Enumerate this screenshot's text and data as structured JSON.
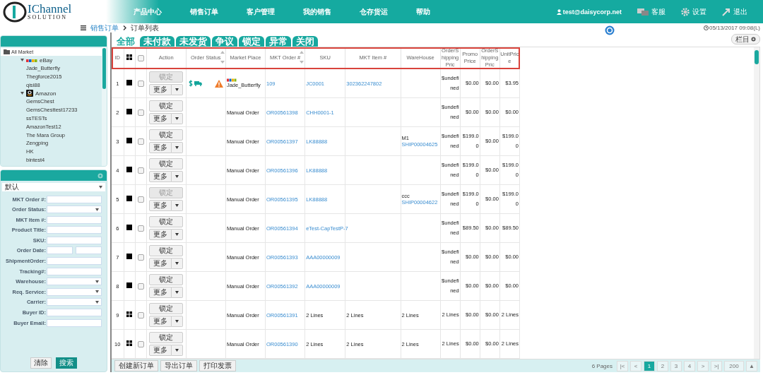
{
  "header": {
    "logo": {
      "main": "IChannel",
      "sub": "SOLUTION"
    },
    "nav": [
      "产品中心",
      "销售订单",
      "客户管理",
      "我的销售",
      "仓存货运",
      "帮助"
    ],
    "user": "test@daisycorp.net",
    "actions": [
      {
        "kind": "support",
        "label": "客服"
      },
      {
        "kind": "settings",
        "label": "设置"
      },
      {
        "kind": "logout",
        "label": "退出"
      }
    ]
  },
  "breadcrumb": {
    "items": [
      "销售订单",
      "订单列表"
    ],
    "timestamp": "05/13/2017 09:08(L)"
  },
  "tree": {
    "root": {
      "label": "All Market",
      "selected": true
    },
    "children": [
      {
        "label": "eBay",
        "kind": "ebay",
        "expanded": true,
        "selected": false,
        "children": [
          {
            "label": "Jade_Butterfly",
            "selected": false
          },
          {
            "label": "Thegforce2015",
            "selected": false
          },
          {
            "label": "qisi88",
            "selected": false
          }
        ]
      },
      {
        "label": "Amazon",
        "kind": "amazon",
        "expanded": true,
        "selected": false,
        "children": [
          {
            "label": "GemsChest",
            "selected": false
          },
          {
            "label": "GemsChesttest17233",
            "selected": false
          },
          {
            "label": "ssTESTs",
            "selected": false
          },
          {
            "label": "AmazonTest12",
            "selected": false
          },
          {
            "label": "The Mara Group",
            "selected": false
          },
          {
            "label": "Zengping",
            "selected": false
          },
          {
            "label": "HK",
            "selected": false
          },
          {
            "label": "bintest4",
            "selected": false
          }
        ]
      }
    ]
  },
  "filter": {
    "preset": "默认",
    "fields": [
      {
        "label": "MKT Order #:",
        "kind": "text"
      },
      {
        "label": "Order Status:",
        "kind": "select"
      },
      {
        "label": "MKT Item #:",
        "kind": "text"
      },
      {
        "label": "Product Title:",
        "kind": "text"
      },
      {
        "label": "SKU:",
        "kind": "text"
      },
      {
        "label": "Order Date:",
        "kind": "range"
      },
      {
        "label": "ShipmentOrder:",
        "kind": "text"
      },
      {
        "label": "Tracking#:",
        "kind": "text"
      },
      {
        "label": "Warehouse:",
        "kind": "select"
      },
      {
        "label": "Req. Service:",
        "kind": "select"
      },
      {
        "label": "Carrier:",
        "kind": "select"
      },
      {
        "label": "Buyer ID:",
        "kind": "text"
      },
      {
        "label": "Buyer Email:",
        "kind": "text"
      }
    ],
    "buttons": [
      {
        "label": "清除",
        "primary": false
      },
      {
        "label": "搜索",
        "primary": true
      }
    ]
  },
  "tabs": [
    {
      "label": "全部",
      "selected": true
    },
    {
      "label": "未付款",
      "selected": false
    },
    {
      "label": "未发货",
      "selected": false
    },
    {
      "label": "争议",
      "selected": false
    },
    {
      "label": "锁定",
      "selected": false
    },
    {
      "label": "异常",
      "selected": false
    },
    {
      "label": "关闭",
      "selected": false
    }
  ],
  "column_button": "栏目",
  "table": {
    "select_all_checked": false,
    "columns": [
      {
        "label": "ID",
        "sortable": false
      },
      {
        "label": "Action",
        "sortable": false
      },
      {
        "label": "Order Status",
        "sortable": true
      },
      {
        "label": "Market Place",
        "sortable": false
      },
      {
        "label": "MKT Order #",
        "sortable": true
      },
      {
        "label": "SKU",
        "sortable": false
      },
      {
        "label": "MKT Item #",
        "sortable": false
      },
      {
        "label": "WareHouse",
        "sortable": false
      },
      {
        "label": "OrderShippingPric",
        "sortable": false
      },
      {
        "label": "PromoPrice",
        "sortable": false
      },
      {
        "label": "OrderShippingPric",
        "sortable": false
      },
      {
        "label": "UnitPrice",
        "sortable": false
      }
    ],
    "rows": [
      {
        "id": "1",
        "kind": "single",
        "checked": false,
        "lock": "锁定",
        "lock_disabled": true,
        "more": "更多",
        "paid": true,
        "shipped": true,
        "alert": true,
        "market_logo": true,
        "market": "Jade_Butterfly",
        "order": "109",
        "sku": "JC0001",
        "sku_link": true,
        "item": "302362247802",
        "warehouse": "",
        "shipment": "",
        "shipping": "$undefined",
        "promo": "$0.00",
        "shipping2": "$0.00",
        "unit": "$3.95"
      },
      {
        "id": "2",
        "kind": "single",
        "checked": false,
        "lock": "锁定",
        "lock_disabled": false,
        "more": "更多",
        "paid": false,
        "shipped": false,
        "alert": false,
        "market_logo": false,
        "market": "Manual Order",
        "order": "OR00561398",
        "sku": "CHH0001-1",
        "sku_link": true,
        "item": "",
        "warehouse": "",
        "shipment": "",
        "shipping": "$undefined",
        "promo": "$0.00",
        "shipping2": "$0.00",
        "unit": "$0.00"
      },
      {
        "id": "3",
        "kind": "single",
        "checked": false,
        "lock": "锁定",
        "lock_disabled": false,
        "more": "更多",
        "paid": false,
        "shipped": false,
        "alert": false,
        "market_logo": false,
        "market": "Manual Order",
        "order": "OR00561397",
        "sku": "LK88888",
        "sku_link": true,
        "item": "",
        "warehouse": "M1",
        "shipment": "SHIP00004625",
        "shipping": "$undefined",
        "promo": "$199.00",
        "shipping2": "$0.00",
        "unit": "$199.00"
      },
      {
        "id": "4",
        "kind": "single",
        "checked": false,
        "lock": "锁定",
        "lock_disabled": false,
        "more": "更多",
        "paid": false,
        "shipped": false,
        "alert": false,
        "market_logo": false,
        "market": "Manual Order",
        "order": "OR00561396",
        "sku": "LK88888",
        "sku_link": true,
        "item": "",
        "warehouse": "",
        "shipment": "",
        "shipping": "$undefined",
        "promo": "$199.00",
        "shipping2": "$0.00",
        "unit": "$199.00"
      },
      {
        "id": "5",
        "kind": "single",
        "checked": false,
        "lock": "锁定",
        "lock_disabled": true,
        "more": "更多",
        "paid": false,
        "shipped": false,
        "alert": false,
        "market_logo": false,
        "market": "Manual Order",
        "order": "OR00561395",
        "sku": "LK88888",
        "sku_link": true,
        "item": "",
        "warehouse": "ccc",
        "shipment": "SHIP00004622",
        "shipping": "$undefined",
        "promo": "$199.00",
        "shipping2": "$0.00",
        "unit": "$199.00"
      },
      {
        "id": "6",
        "kind": "single",
        "checked": false,
        "lock": "锁定",
        "lock_disabled": false,
        "more": "更多",
        "paid": false,
        "shipped": false,
        "alert": false,
        "market_logo": false,
        "market": "Manual Order",
        "order": "OR00561394",
        "sku": "eTest-CapTestP-7",
        "sku_link": true,
        "item": "",
        "warehouse": "",
        "shipment": "",
        "shipping": "$undefined",
        "promo": "$89.50",
        "shipping2": "$0.00",
        "unit": "$89.50"
      },
      {
        "id": "7",
        "kind": "single",
        "checked": false,
        "lock": "锁定",
        "lock_disabled": false,
        "more": "更多",
        "paid": false,
        "shipped": false,
        "alert": false,
        "market_logo": false,
        "market": "Manual Order",
        "order": "OR00561393",
        "sku": "AAA00000009",
        "sku_link": true,
        "item": "",
        "warehouse": "",
        "shipment": "",
        "shipping": "$undefined",
        "promo": "$0.00",
        "shipping2": "$0.00",
        "unit": "$0.00"
      },
      {
        "id": "8",
        "kind": "single",
        "checked": false,
        "lock": "锁定",
        "lock_disabled": false,
        "more": "更多",
        "paid": false,
        "shipped": false,
        "alert": false,
        "market_logo": false,
        "market": "Manual Order",
        "order": "OR00561392",
        "sku": "AAA00000009",
        "sku_link": true,
        "item": "",
        "warehouse": "",
        "shipment": "",
        "shipping": "$undefined",
        "promo": "$0.00",
        "shipping2": "$0.00",
        "unit": "$0.00"
      },
      {
        "id": "9",
        "kind": "multi",
        "checked": false,
        "lock": "锁定",
        "lock_disabled": false,
        "more": "更多",
        "paid": false,
        "shipped": false,
        "alert": false,
        "market_logo": false,
        "market": "Manual Order",
        "order": "OR00561391",
        "sku": "2 Lines",
        "sku_link": false,
        "item": "2 Lines",
        "warehouse": "2 Lines",
        "shipment": "",
        "shipping": "2 Lines",
        "promo": "$0.00",
        "shipping2": "$0.00",
        "unit": "2 Lines"
      },
      {
        "id": "10",
        "kind": "multi",
        "checked": false,
        "lock": "锁定",
        "lock_disabled": false,
        "more": "更多",
        "paid": false,
        "shipped": false,
        "alert": false,
        "market_logo": false,
        "market": "Manual Order",
        "order": "OR00561390",
        "sku": "2 Lines",
        "sku_link": false,
        "item": "2 Lines",
        "warehouse": "2 Lines",
        "shipment": "",
        "shipping": "2 Lines",
        "promo": "$0.00",
        "shipping2": "$0.00",
        "unit": "2 Lines"
      }
    ]
  },
  "footer_buttons": [
    "创建新订单",
    "导出订单",
    "打印发票"
  ],
  "pagination": {
    "summary": "6 Pages",
    "first": "|<",
    "prev": "<",
    "pages": [
      {
        "label": "1",
        "selected": true
      },
      {
        "label": "2",
        "selected": false
      },
      {
        "label": "3",
        "selected": false
      },
      {
        "label": "4",
        "selected": false
      }
    ],
    "next": ">",
    "last": ">|",
    "page_size": "200",
    "size_toggle": "▲"
  }
}
